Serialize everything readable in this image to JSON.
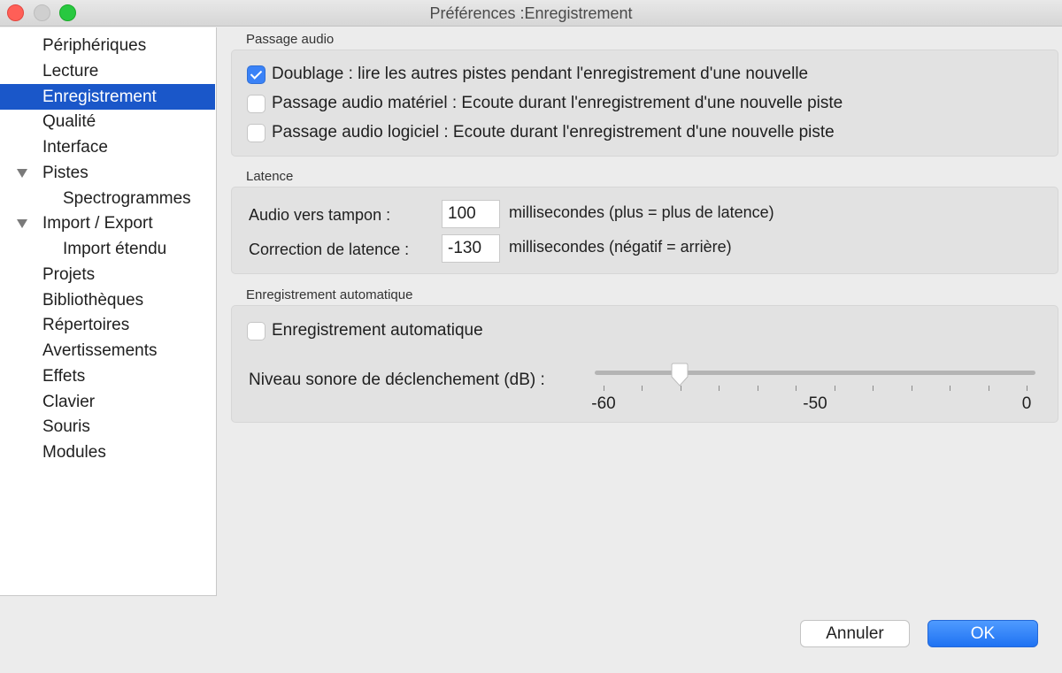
{
  "window": {
    "title": "Préférences :Enregistrement",
    "controls": [
      "close",
      "minimize",
      "zoom"
    ]
  },
  "sidebar": {
    "items": [
      {
        "label": "Périphériques",
        "level": 0,
        "selected": false
      },
      {
        "label": "Lecture",
        "level": 0,
        "selected": false
      },
      {
        "label": "Enregistrement",
        "level": 0,
        "selected": true
      },
      {
        "label": "Qualité",
        "level": 0,
        "selected": false
      },
      {
        "label": "Interface",
        "level": 0,
        "selected": false
      },
      {
        "label": "Pistes",
        "level": 0,
        "selected": false,
        "expanded": true
      },
      {
        "label": "Spectrogrammes",
        "level": 1,
        "selected": false
      },
      {
        "label": "Import / Export",
        "level": 0,
        "selected": false,
        "expanded": true
      },
      {
        "label": "Import étendu",
        "level": 1,
        "selected": false
      },
      {
        "label": "Projets",
        "level": 0,
        "selected": false
      },
      {
        "label": "Bibliothèques",
        "level": 0,
        "selected": false
      },
      {
        "label": "Répertoires",
        "level": 0,
        "selected": false
      },
      {
        "label": "Avertissements",
        "level": 0,
        "selected": false
      },
      {
        "label": "Effets",
        "level": 0,
        "selected": false
      },
      {
        "label": "Clavier",
        "level": 0,
        "selected": false
      },
      {
        "label": "Souris",
        "level": 0,
        "selected": false
      },
      {
        "label": "Modules",
        "level": 0,
        "selected": false
      }
    ]
  },
  "passage_audio": {
    "title": "Passage audio",
    "options": [
      {
        "label": "Doublage : lire les autres pistes pendant l'enregistrement d'une nouvelle",
        "checked": true
      },
      {
        "label": "Passage audio matériel : Ecoute durant l'enregistrement d'une nouvelle piste",
        "checked": false
      },
      {
        "label": "Passage audio logiciel : Ecoute durant l'enregistrement d'une nouvelle piste",
        "checked": false
      }
    ]
  },
  "latence": {
    "title": "Latence",
    "buffer": {
      "label": "Audio vers tampon :",
      "value": "100",
      "unit": "millisecondes (plus = plus de latence)"
    },
    "correction": {
      "label": "Correction de latence :",
      "value": "-130",
      "unit": "millisecondes (négatif = arrière)"
    }
  },
  "auto_record": {
    "title": "Enregistrement automatique",
    "checkbox": {
      "label": "Enregistrement automatique",
      "checked": false
    },
    "level": {
      "label": "Niveau sonore de déclenchement (dB) :",
      "value_fraction": 0.18,
      "tick_count": 12,
      "tick_labels": [
        "-60",
        "-50",
        "0"
      ]
    }
  },
  "buttons": {
    "cancel": "Annuler",
    "ok": "OK"
  },
  "colors": {
    "selection": "#1a57c9",
    "accent": "#3a82f7",
    "ok_button": "#1f72f2"
  }
}
